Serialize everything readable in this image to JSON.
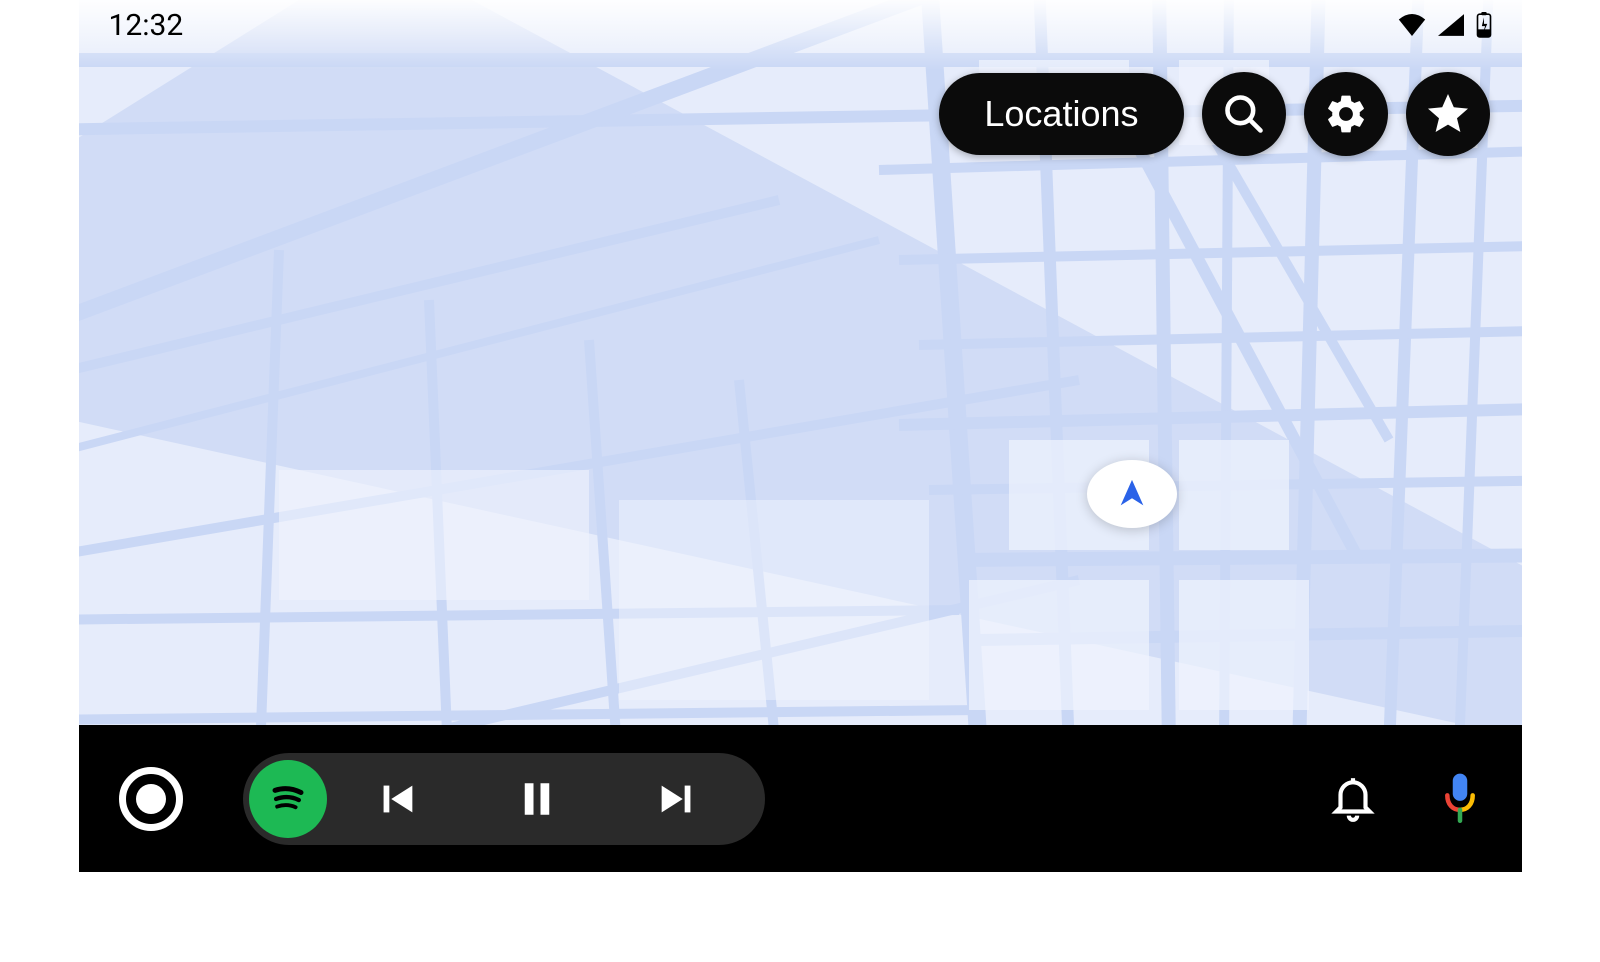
{
  "status": {
    "time": "12:32"
  },
  "map": {
    "controls": {
      "locations_label": "Locations"
    }
  },
  "colors": {
    "spotify_green": "#1DB954",
    "assistant_blue": "#4285F4",
    "assistant_red": "#EA4335",
    "assistant_yellow": "#FBBC04",
    "assistant_green": "#34A853"
  }
}
